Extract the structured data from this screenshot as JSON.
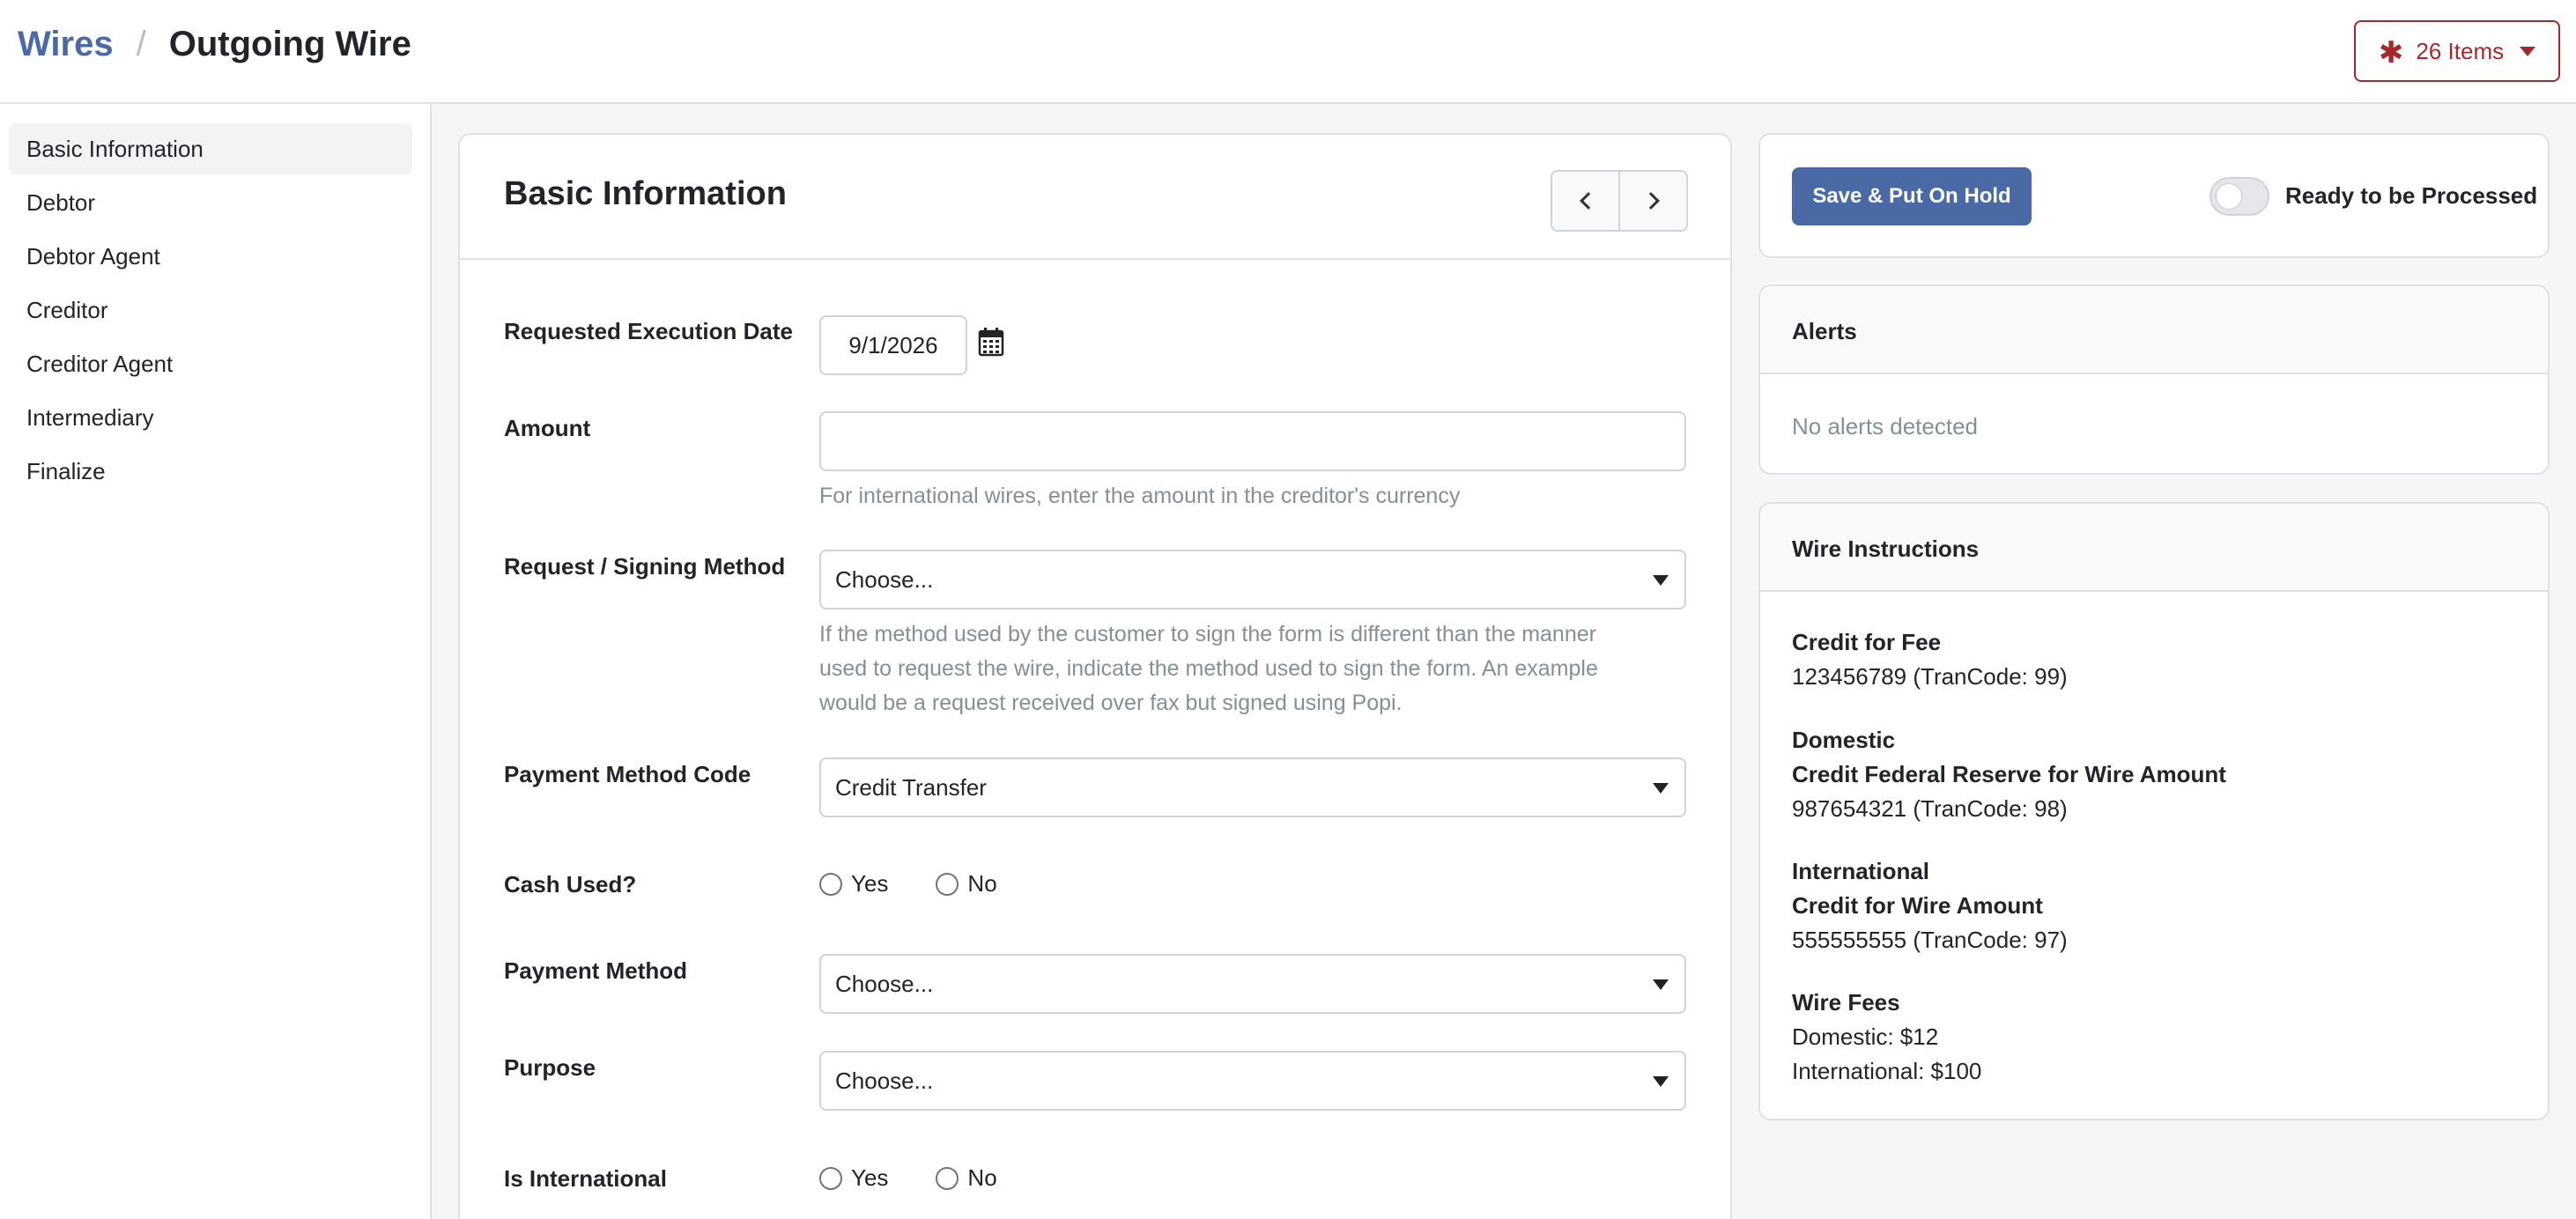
{
  "header": {
    "breadcrumb_root": "Wires",
    "breadcrumb_separator": "/",
    "breadcrumb_current": "Outgoing Wire",
    "items_button": "26 Items",
    "items_icon": "asterisk-icon",
    "accent_color": "#a7272a",
    "brand_color": "#4a6aa5"
  },
  "sidebar": {
    "items": [
      {
        "label": "Basic Information",
        "active": true
      },
      {
        "label": "Debtor"
      },
      {
        "label": "Debtor Agent"
      },
      {
        "label": "Creditor"
      },
      {
        "label": "Creditor Agent"
      },
      {
        "label": "Intermediary"
      },
      {
        "label": "Finalize"
      }
    ]
  },
  "form": {
    "title": "Basic Information",
    "requested_execution_date": {
      "label": "Requested Execution Date",
      "value": "9/1/2026"
    },
    "amount": {
      "label": "Amount",
      "value": "",
      "help": "For international wires, enter the amount in the creditor's currency"
    },
    "signing_method": {
      "label": "Request / Signing Method",
      "value": "Choose...",
      "help_lines": [
        "If the method used by the customer to sign the form is different than the manner",
        "used to request the wire, indicate the method used to sign the form. An example",
        "would be a request received over fax but signed using Popi."
      ]
    },
    "payment_method_code": {
      "label": "Payment Method Code",
      "value": "Credit Transfer"
    },
    "cash_used": {
      "label": "Cash Used?",
      "yes": "Yes",
      "no": "No"
    },
    "payment_method": {
      "label": "Payment Method",
      "value": "Choose..."
    },
    "purpose": {
      "label": "Purpose",
      "value": "Choose..."
    },
    "is_international": {
      "label": "Is International",
      "yes": "Yes",
      "no": "No"
    }
  },
  "actions": {
    "save_button": "Save & Put On Hold",
    "toggle_label": "Ready to be Processed",
    "toggle_on": false
  },
  "alerts": {
    "title": "Alerts",
    "message": "No alerts detected"
  },
  "wire_instructions": {
    "title": "Wire Instructions",
    "fee": {
      "heading": "Credit for Fee",
      "line": "123456789 (TranCode: 99)"
    },
    "domestic": {
      "heading": "Domestic",
      "subheading": "Credit Federal Reserve for Wire Amount",
      "line": "987654321 (TranCode: 98)"
    },
    "international": {
      "heading": "International",
      "subheading": "Credit for Wire Amount",
      "line": "555555555 (TranCode: 97)"
    },
    "wire_fees": {
      "heading": "Wire Fees",
      "domestic": "Domestic: $12",
      "international": "International: $100"
    }
  }
}
